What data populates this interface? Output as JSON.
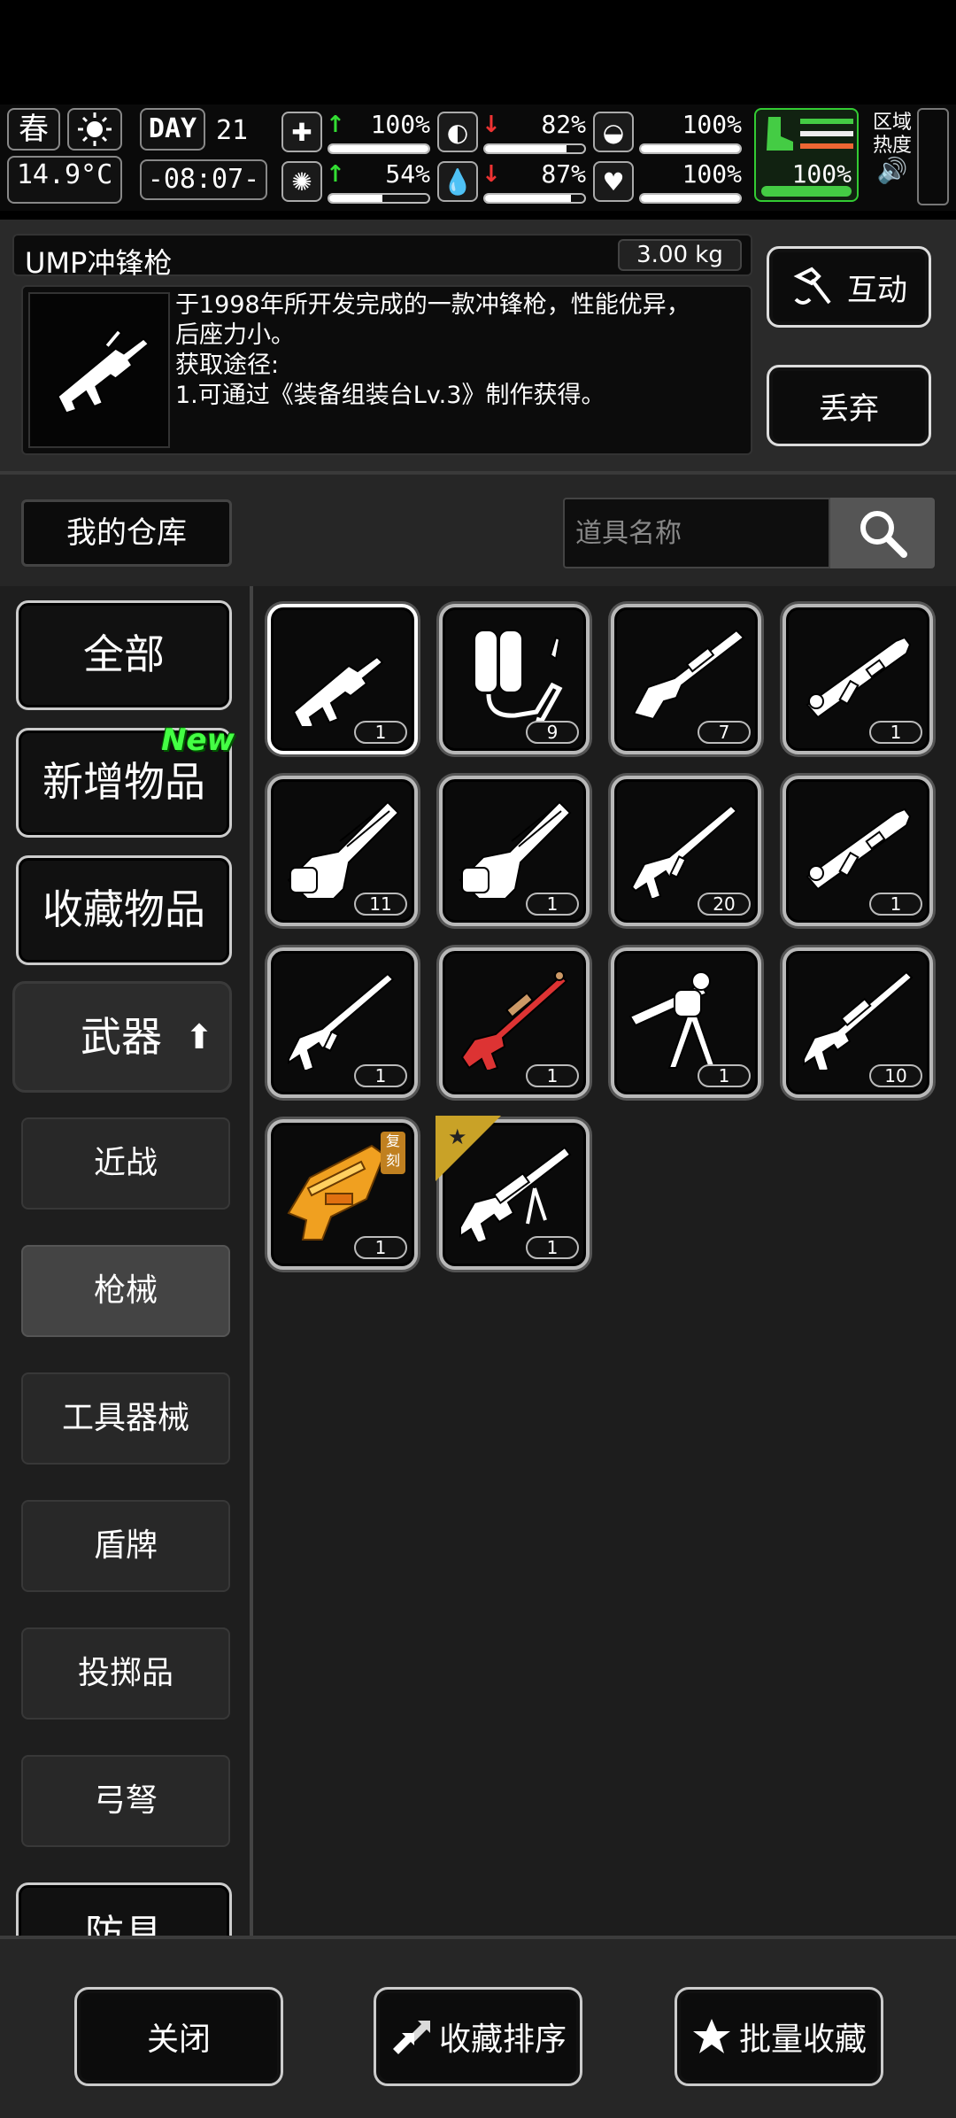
{
  "status": {
    "season": "春",
    "temperature": "14.9°C",
    "day_label": "DAY",
    "day_number": "21",
    "clock": "-08:07-",
    "stats": [
      {
        "name": "health",
        "icon": "medkit-icon",
        "glyph": "✚",
        "trend": "up",
        "value": "100%",
        "level": 1.0
      },
      {
        "name": "hunger",
        "icon": "stomach-icon",
        "glyph": "◐",
        "trend": "down",
        "value": "82%",
        "level": 0.82
      },
      {
        "name": "armor",
        "icon": "helmet-icon",
        "glyph": "◒",
        "trend": "none",
        "value": "100%",
        "level": 1.0
      },
      {
        "name": "mind",
        "icon": "brain-icon",
        "glyph": "✺",
        "trend": "up",
        "value": "54%",
        "level": 0.54
      },
      {
        "name": "thirst",
        "icon": "water-drop-icon",
        "glyph": "💧",
        "trend": "down",
        "value": "87%",
        "level": 0.87
      },
      {
        "name": "mood",
        "icon": "heart-icon",
        "glyph": "♥",
        "trend": "none",
        "value": "100%",
        "level": 1.0
      }
    ],
    "stamina": {
      "value": "100%",
      "level": 1.0
    },
    "area_heat": "区域\n热度",
    "colors": {
      "up": "#33dd33",
      "down": "#ee3333",
      "stamina": "#44cc44"
    }
  },
  "detail": {
    "name": "UMP冲锋枪",
    "weight": "3.00 kg",
    "description": "于1998年所开发完成的一款冲锋枪，性能优异，\n后座力小。\n获取途径:\n1.可通过《装备组装台Lv.3》制作获得。",
    "interact_label": "互动",
    "drop_label": "丢弃"
  },
  "warehouse": {
    "title": "我的仓库",
    "search_placeholder": "道具名称"
  },
  "sidebar": {
    "categories": [
      {
        "label": "全部"
      },
      {
        "label": "新增物品",
        "tag": "New"
      },
      {
        "label": "收藏物品"
      }
    ],
    "weapon_label": "武器",
    "subcategories": [
      {
        "label": "近战",
        "active": false
      },
      {
        "label": "枪械",
        "active": true
      },
      {
        "label": "工具器械",
        "active": false
      },
      {
        "label": "盾牌",
        "active": false
      },
      {
        "label": "投掷品",
        "active": false
      },
      {
        "label": "弓弩",
        "active": false
      },
      {
        "label": "防具",
        "active": false
      }
    ]
  },
  "items": [
    {
      "icon": "smg-icon",
      "qty": "1",
      "selected": true
    },
    {
      "icon": "flamethrower-icon",
      "qty": "9"
    },
    {
      "icon": "shotgun-icon",
      "qty": "7"
    },
    {
      "icon": "rocket-launcher-icon",
      "qty": "1"
    },
    {
      "icon": "minigun-icon",
      "qty": "11"
    },
    {
      "icon": "minigun-icon",
      "qty": "1"
    },
    {
      "icon": "assault-rifle-icon",
      "qty": "20"
    },
    {
      "icon": "rocket-launcher-icon",
      "qty": "1"
    },
    {
      "icon": "rifle-icon",
      "qty": "1"
    },
    {
      "icon": "red-sniper-rifle-icon",
      "qty": "1"
    },
    {
      "icon": "mounted-gun-icon",
      "qty": "1"
    },
    {
      "icon": "sniper-rifle-icon",
      "qty": "10"
    },
    {
      "icon": "golden-gun-icon",
      "qty": "1",
      "badge": "复刻"
    },
    {
      "icon": "machine-gun-icon",
      "qty": "1",
      "star": true
    }
  ],
  "bottom": {
    "close_label": "关闭",
    "sort_label": "收藏排序",
    "batch_label": "批量收藏"
  }
}
